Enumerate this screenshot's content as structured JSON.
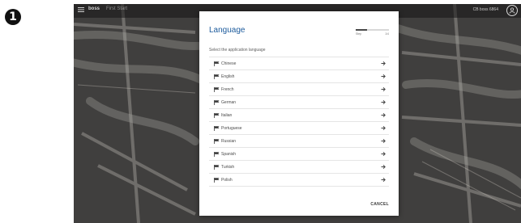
{
  "step_number": "1",
  "topbar": {
    "app_name": "boss",
    "app_subtitle": "First Start",
    "device_id": "CB boss 6864",
    "menu_icon": "hamburger-menu-icon",
    "user_icon": "user-account-icon"
  },
  "dialog": {
    "title": "Language",
    "progress": {
      "start_label": "Step",
      "end_label": "1/4",
      "value": 0.35
    },
    "instruction": "Select the application language",
    "languages": [
      {
        "label": "Chinese"
      },
      {
        "label": "English"
      },
      {
        "label": "French"
      },
      {
        "label": "German"
      },
      {
        "label": "Italian"
      },
      {
        "label": "Portuguese"
      },
      {
        "label": "Russian"
      },
      {
        "label": "Spanish"
      },
      {
        "label": "Turkish"
      },
      {
        "label": "Polish"
      }
    ],
    "cancel_label": "CANCEL",
    "row_icon": "flag-icon",
    "row_action_icon": "arrow-right-icon"
  },
  "colors": {
    "title": "#1b5a9c",
    "background_overlay": "#3d3c3b",
    "dialog_bg": "#ffffff"
  }
}
